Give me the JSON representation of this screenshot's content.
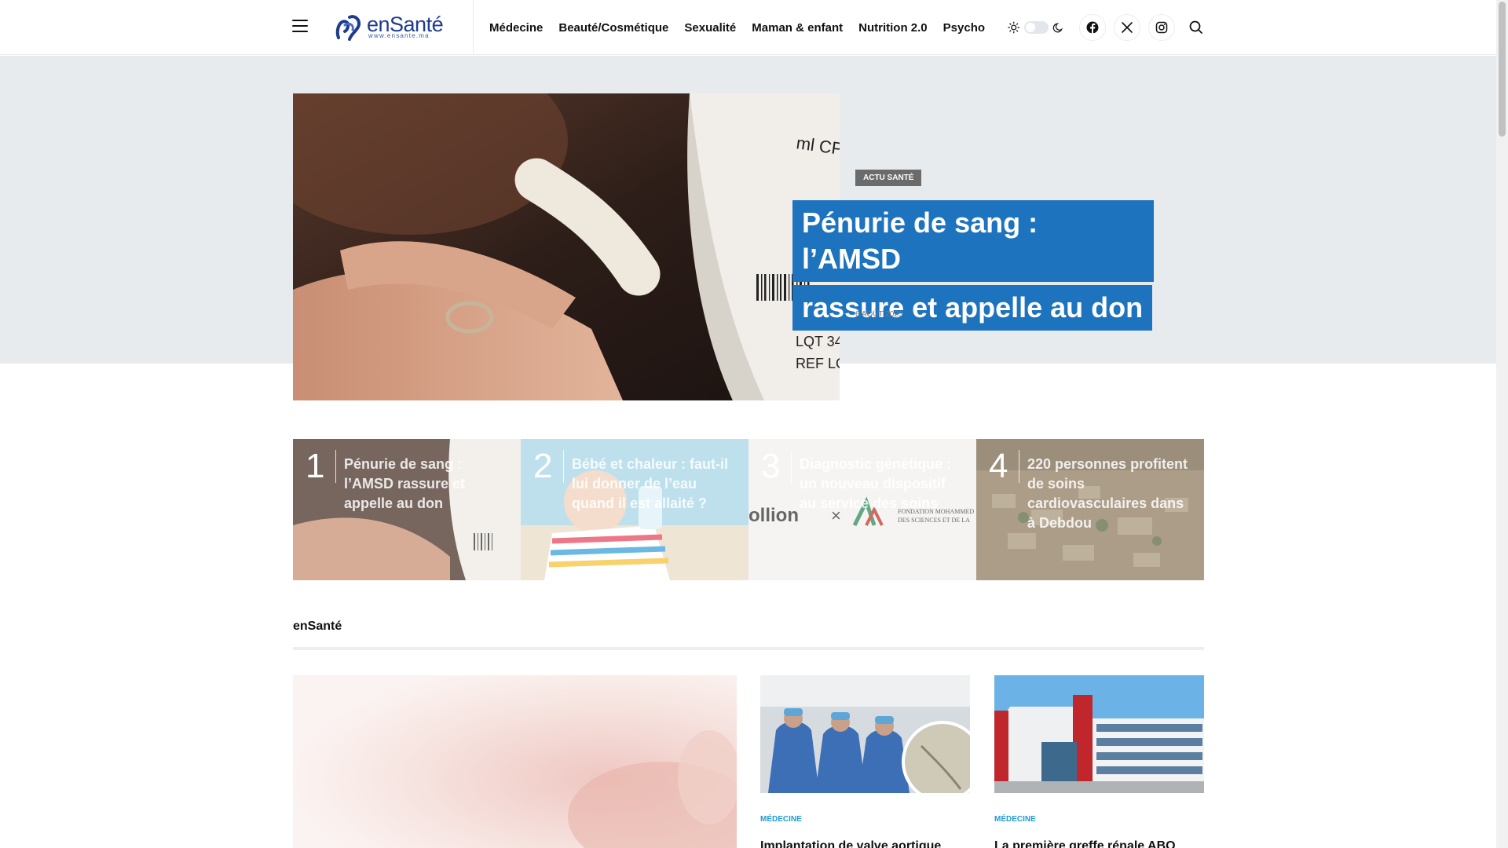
{
  "header": {
    "logo_text": "enSanté",
    "logo_subtext": "www.ensante.ma",
    "nav": [
      "Médecine",
      "Beauté/Cosmétique",
      "Sexualité",
      "Maman & enfant",
      "Nutrition 2.0",
      "Psycho"
    ]
  },
  "hero": {
    "category": "ACTU SANTÉ",
    "title_line1": "Pénurie de sang : l’AMSD",
    "title_line2": "rassure et appelle au don",
    "date": "6 AOÛT 2025"
  },
  "trending": [
    {
      "num": "1",
      "title": "Pénurie de sang : l’AMSD rassure et appelle au don"
    },
    {
      "num": "2",
      "title": "Bébé et chaleur : faut-il lui donner de l’eau quand il est allaité ?"
    },
    {
      "num": "3",
      "title": "Diagnostic génétique : un nouveau dispositif au service des soins"
    },
    {
      "num": "4",
      "title": "220 personnes profitent de soins cardiovasculaires dans à Debdou"
    }
  ],
  "section": {
    "title": "enSanté",
    "cards": [
      {
        "category": "MÉDECINE",
        "title": "Implantation de valve aortique"
      },
      {
        "category": "MÉDECINE",
        "title": "La première greffe rénale ABO"
      }
    ]
  },
  "colors": {
    "accent": "#1e73be",
    "category": "#1e9bd7",
    "logo": "#1e3b8f"
  }
}
